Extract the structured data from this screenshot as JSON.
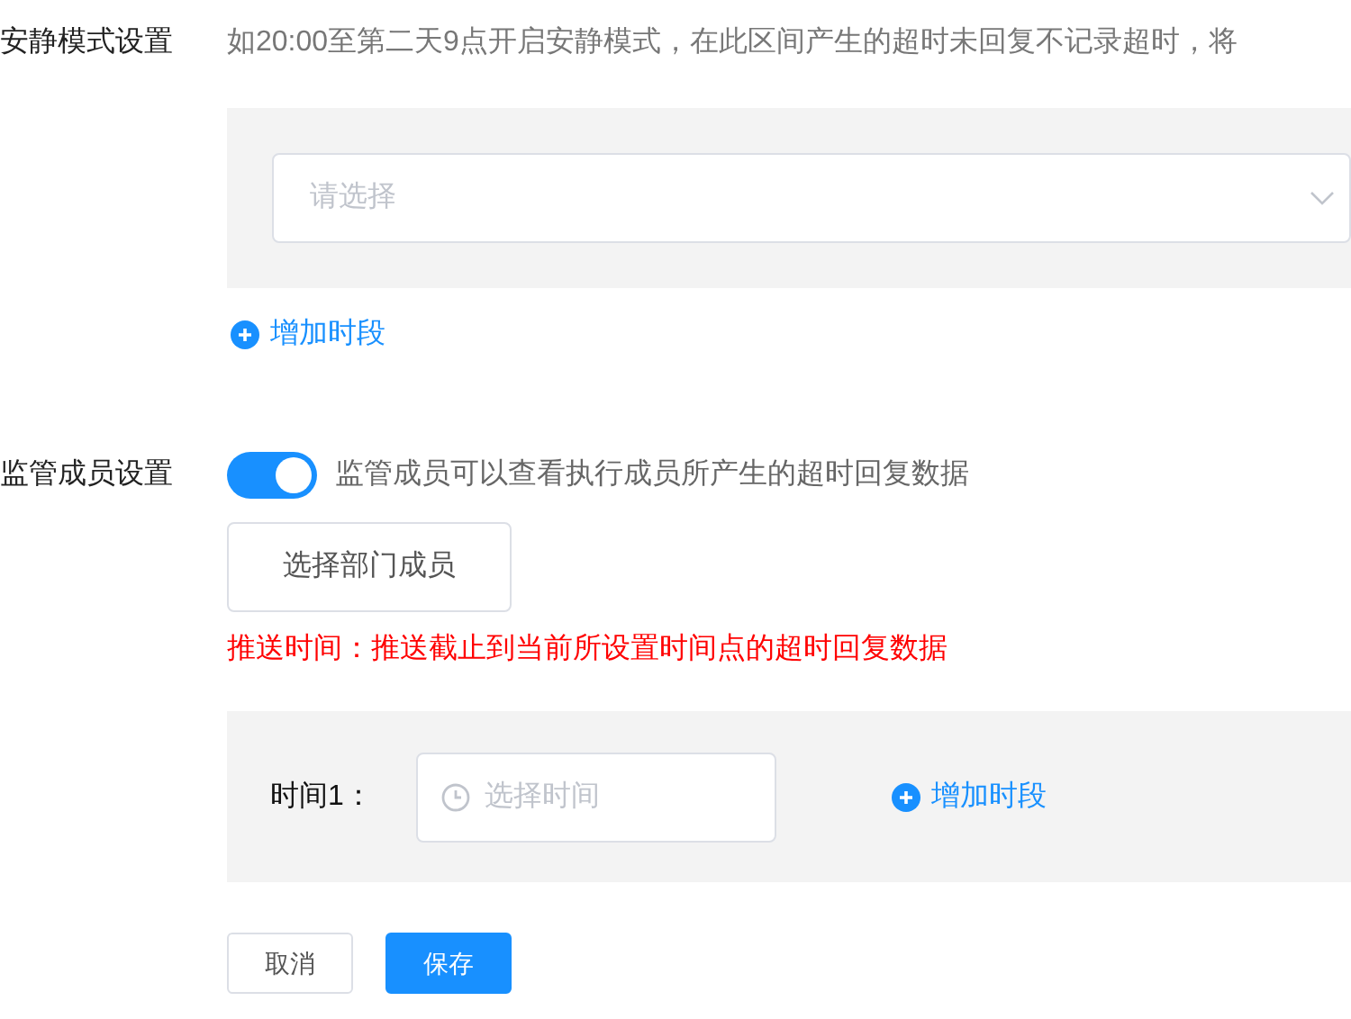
{
  "quiet_mode": {
    "label": "安静模式设置",
    "description": "如20:00至第二天9点开启安静模式，在此区间产生的超时未回复不记录超时，将",
    "select": {
      "placeholder": "请选择"
    },
    "add_period": "增加时段"
  },
  "supervisor": {
    "label": "监管成员设置",
    "toggle": {
      "on": true,
      "label": "监管成员可以查看执行成员所产生的超时回复数据"
    },
    "select_button": "选择部门成员",
    "notice": "推送时间：推送截止到当前所设置时间点的超时回复数据",
    "times": [
      {
        "label": "时间1：",
        "placeholder": "选择时间",
        "add_period": "增加时段"
      }
    ]
  },
  "buttons": [
    {
      "kind": "default",
      "label": "取消"
    },
    {
      "kind": "primary",
      "label": "保存"
    }
  ]
}
